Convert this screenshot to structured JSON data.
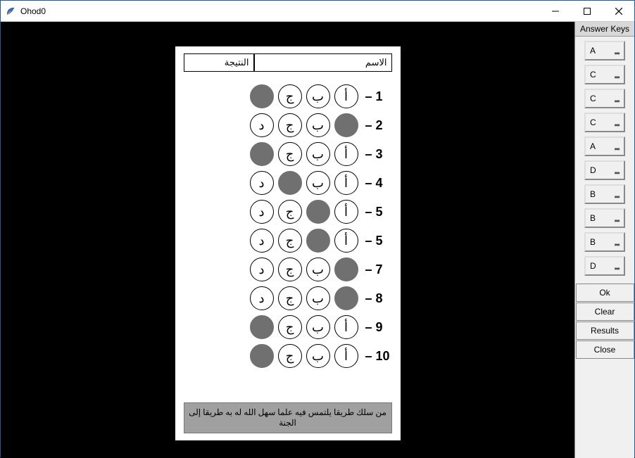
{
  "window": {
    "title": "Ohod0"
  },
  "sheet": {
    "result_label": "النتيجة",
    "name_label": "الاسم",
    "options_rtl": [
      "أ",
      "ب",
      "ج",
      "د"
    ],
    "rows": [
      {
        "num": 1,
        "filled": "د"
      },
      {
        "num": 2,
        "filled": "أ"
      },
      {
        "num": 3,
        "filled": "د"
      },
      {
        "num": 4,
        "filled": "ج"
      },
      {
        "num": 5,
        "filled": "ب"
      },
      {
        "num": 5,
        "filled": "ب"
      },
      {
        "num": 7,
        "filled": "أ"
      },
      {
        "num": 8,
        "filled": "أ"
      },
      {
        "num": 9,
        "filled": "د"
      },
      {
        "num": 10,
        "filled": "د"
      }
    ],
    "footer_text": "من سلك طريقا يلتمس فيه علما سهل الله له به طريقا إلى الجنة"
  },
  "panel": {
    "title": "Answer Keys",
    "keys": [
      "A",
      "C",
      "C",
      "C",
      "A",
      "D",
      "B",
      "B",
      "B",
      "D"
    ],
    "buttons": {
      "ok": "Ok",
      "clear": "Clear",
      "results": "Results",
      "close": "Close"
    }
  }
}
